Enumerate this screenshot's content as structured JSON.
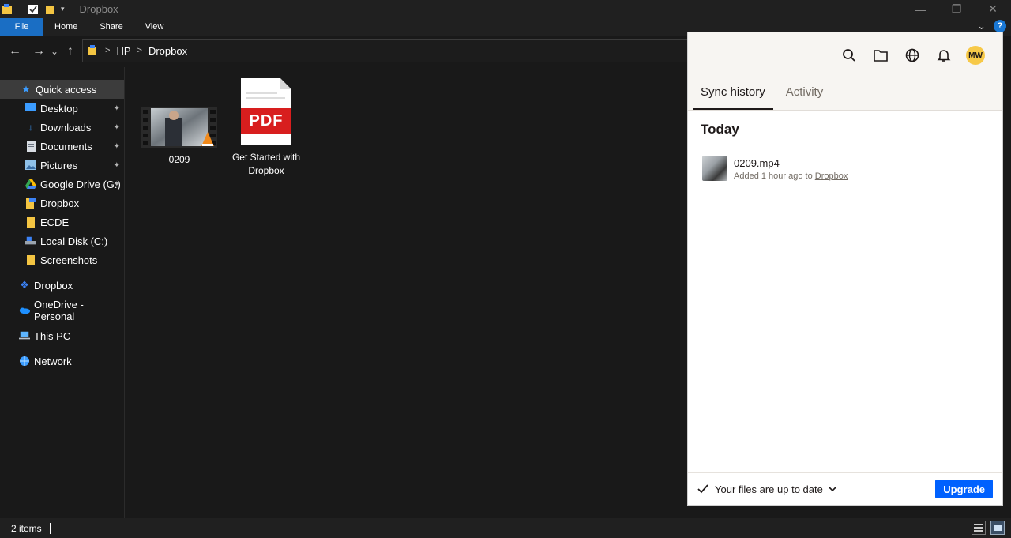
{
  "window": {
    "title": "Dropbox",
    "minimize_glyph": "—",
    "restore_glyph": "❐",
    "close_glyph": "✕"
  },
  "ribbon": {
    "tabs": [
      "File",
      "Home",
      "Share",
      "View"
    ],
    "help_glyph": "?",
    "expand_glyph": "⌄"
  },
  "address": {
    "back_glyph": "←",
    "forward_glyph": "→",
    "recent_glyph": "⌄",
    "up_glyph": "↑",
    "crumbs": [
      "HP",
      "Dropbox"
    ],
    "sep_glyph": ">"
  },
  "sidebar": {
    "quick_access": "Quick access",
    "pinned": [
      {
        "label": "Desktop",
        "icon": "desktop-icon",
        "pinned": true
      },
      {
        "label": "Downloads",
        "icon": "downloads-icon",
        "pinned": true
      },
      {
        "label": "Documents",
        "icon": "documents-icon",
        "pinned": true
      },
      {
        "label": "Pictures",
        "icon": "pictures-icon",
        "pinned": true
      },
      {
        "label": "Google Drive (G:)",
        "icon": "google-drive-icon",
        "pinned": true
      },
      {
        "label": "Dropbox",
        "icon": "dropbox-folder-icon",
        "pinned": false
      },
      {
        "label": "ECDE",
        "icon": "folder-icon",
        "pinned": false
      },
      {
        "label": "Local Disk (C:)",
        "icon": "disk-icon",
        "pinned": false
      },
      {
        "label": "Screenshots",
        "icon": "folder-icon",
        "pinned": false
      }
    ],
    "roots": [
      {
        "label": "Dropbox",
        "icon": "dropbox-icon"
      },
      {
        "label": "OneDrive - Personal",
        "icon": "onedrive-icon"
      },
      {
        "label": "This PC",
        "icon": "this-pc-icon"
      },
      {
        "label": "Network",
        "icon": "network-icon"
      }
    ],
    "pin_glyph": "📌"
  },
  "files": [
    {
      "name": "0209",
      "type": "video"
    },
    {
      "name": "Get Started with Dropbox",
      "type": "pdf",
      "badge": "PDF"
    }
  ],
  "status": {
    "count": "2 items"
  },
  "dropbox_panel": {
    "avatar_initials": "MW",
    "tabs": [
      "Sync history",
      "Activity"
    ],
    "section": "Today",
    "items": [
      {
        "name": "0209.mp4",
        "detail_prefix": "Added 1 hour ago to ",
        "location": "Dropbox"
      }
    ],
    "footer_status": "Your files are up to date",
    "upgrade_label": "Upgrade"
  }
}
